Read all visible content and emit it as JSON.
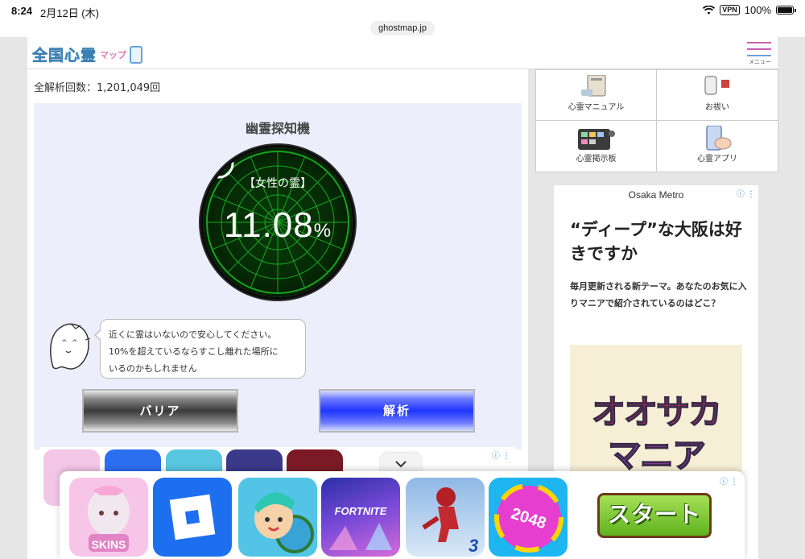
{
  "status_bar": {
    "time": "8:24",
    "date": "2月12日 (木)",
    "vpn": "VPN",
    "battery": "100%"
  },
  "browser": {
    "domain": "ghostmap.jp"
  },
  "header": {
    "logo_text": "全国心霊",
    "logo_sub": "マップ",
    "menu_label": "メニュー"
  },
  "stats": {
    "analysis_count": "全解析回数：1,201,049回"
  },
  "detector": {
    "title": "幽霊探知機",
    "spirit_type": "【女性の霊】",
    "value": "11.08",
    "unit": "%",
    "message_lines": [
      "近くに霊はいないので安心してください。",
      "10%を超えているならすこし離れた場所に",
      "いるのかもしれません"
    ],
    "barrier_label": "バリア",
    "analyze_label": "解析"
  },
  "sidebar": {
    "items": [
      {
        "label": "心霊マニュアル",
        "icon": "manual-icon"
      },
      {
        "label": "お祓い",
        "icon": "exorcism-icon"
      },
      {
        "label": "心霊掲示板",
        "icon": "board-icon"
      },
      {
        "label": "心霊アプリ",
        "icon": "app-icon"
      }
    ]
  },
  "side_ad": {
    "brand": "Osaka Metro",
    "headline": "“ディープ”な大阪は好きですか",
    "sub": "毎月更新される新テーマ。あなたのお気に入りマニアで紹介されているのはどこ？",
    "banner_line1": "オオサカ",
    "banner_line2": "マニア"
  },
  "bottom_ad": {
    "start_label": "スタート",
    "apps": [
      "SKINS",
      "Roblox",
      "Toca",
      "FORTNITE",
      "Runner 3",
      "2048"
    ]
  },
  "colors": {
    "radar_green": "#22e02a",
    "barrier_dark": "#3a3a3a",
    "analyze_blue": "#1e36ff",
    "detector_bg": "#eceefb"
  }
}
